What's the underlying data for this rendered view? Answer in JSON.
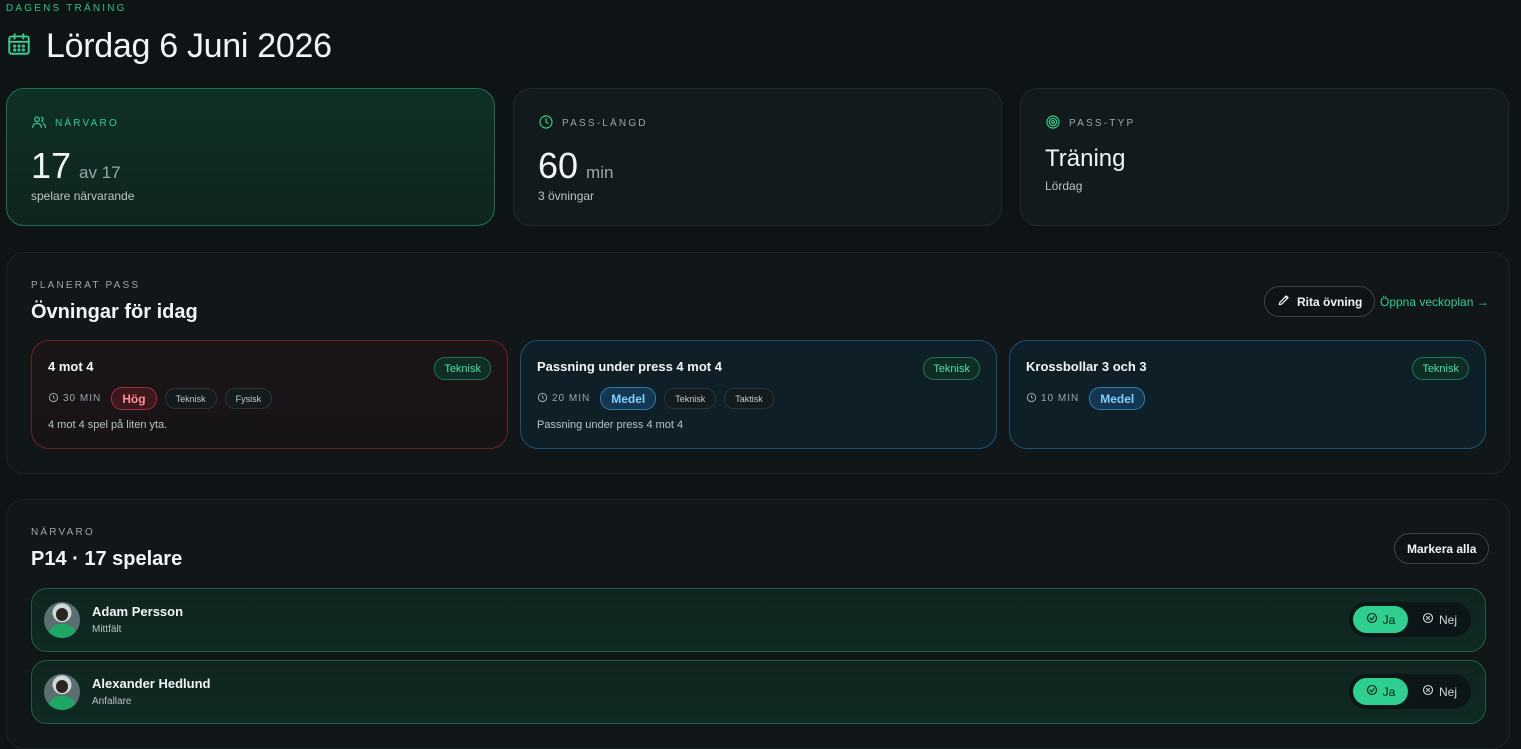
{
  "header": {
    "eyebrow": "DAGENS TRÄNING",
    "title": "Lördag 6 Juni 2026"
  },
  "stats": [
    {
      "label": "NÄRVARO",
      "value": "17",
      "unit": "av 17",
      "sub": "spelare närvarande",
      "icon": "users-icon",
      "active": true
    },
    {
      "label": "PASS-LÄNGD",
      "value": "60",
      "unit": "min",
      "sub": "3 övningar",
      "icon": "clock-icon",
      "active": false
    },
    {
      "label": "PASS-TYP",
      "value": "Träning",
      "sub": "Lördag",
      "icon": "target-icon",
      "active": false
    }
  ],
  "exercises_panel": {
    "eyebrow": "PLANERAT PASS",
    "title": "Övningar för idag",
    "draw_button": "Rita övning",
    "week_link": "Öppna veckoplan →",
    "items": [
      {
        "title": "4 mot 4",
        "category": "Teknisk",
        "duration": "30 MIN",
        "intensity": "Hög",
        "tags": [
          "Teknisk",
          "Fysisk"
        ],
        "description": "4 mot 4 spel på liten yta."
      },
      {
        "title": "Passning under press 4 mot 4",
        "category": "Teknisk",
        "duration": "20 MIN",
        "intensity": "Medel",
        "tags": [
          "Teknisk",
          "Taktisk"
        ],
        "description": "Passning under press 4 mot 4"
      },
      {
        "title": "Krossbollar 3 och 3",
        "category": "Teknisk",
        "duration": "10 MIN",
        "intensity": "Medel",
        "tags": [],
        "description": ""
      }
    ]
  },
  "attendance_panel": {
    "eyebrow": "NÄRVARO",
    "title": "P14 · 17 spelare",
    "mark_all": "Markera alla",
    "yes_label": "Ja",
    "no_label": "Nej",
    "players": [
      {
        "name": "Adam Persson",
        "position": "Mittfält",
        "present": true
      },
      {
        "name": "Alexander Hedlund",
        "position": "Anfallare",
        "present": true
      }
    ]
  },
  "colors": {
    "accent": "#2fd08f",
    "hard": "#ff8f96",
    "medium": "#7fd0ff",
    "background": "#0e1416"
  }
}
